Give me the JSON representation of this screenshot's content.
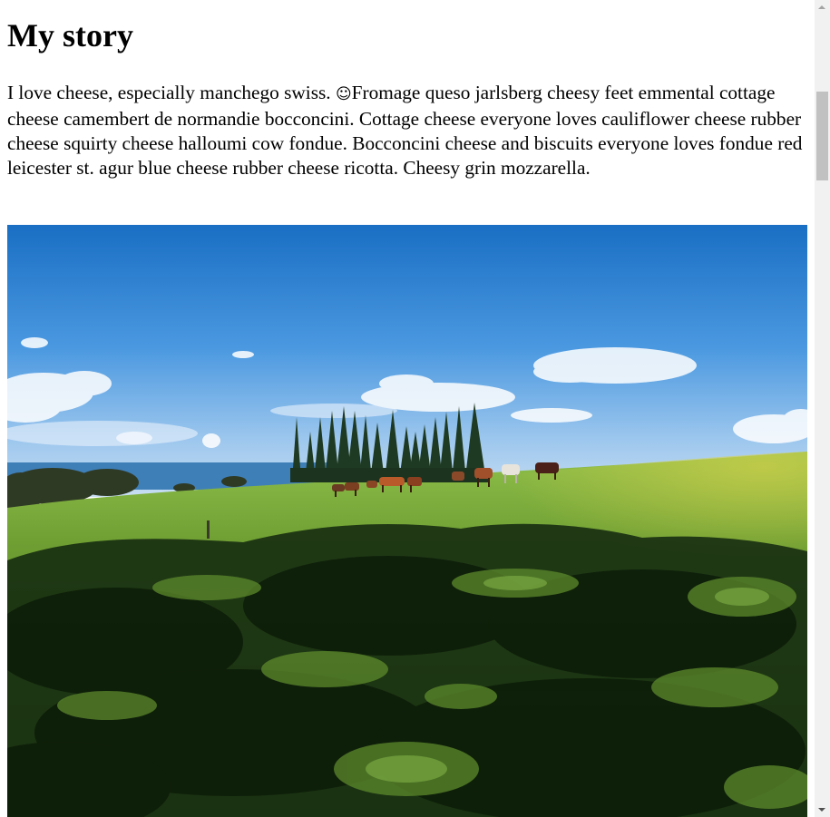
{
  "article": {
    "title": "My story",
    "paragraph_start": "I love cheese, especially manchego swiss. ",
    "emoji": "☺",
    "paragraph_rest": "Fromage queso jarlsberg cheesy feet emmental cottage cheese camembert de normandie bocconcini. Cottage cheese everyone loves cauliflower cheese rubber cheese squirty cheese halloumi cow fondue. Bocconcini cheese and biscuits everyone loves fondue red leicester st. agur blue cheese rubber cheese ricotta. Cheesy grin mozzarella."
  },
  "image": {
    "subject": "horses grazing on a green hillside under a blue sky"
  },
  "scrollbar": {
    "up_icon": "chevron-up-icon",
    "down_icon": "chevron-down-icon",
    "scroll_position": 0.12
  }
}
